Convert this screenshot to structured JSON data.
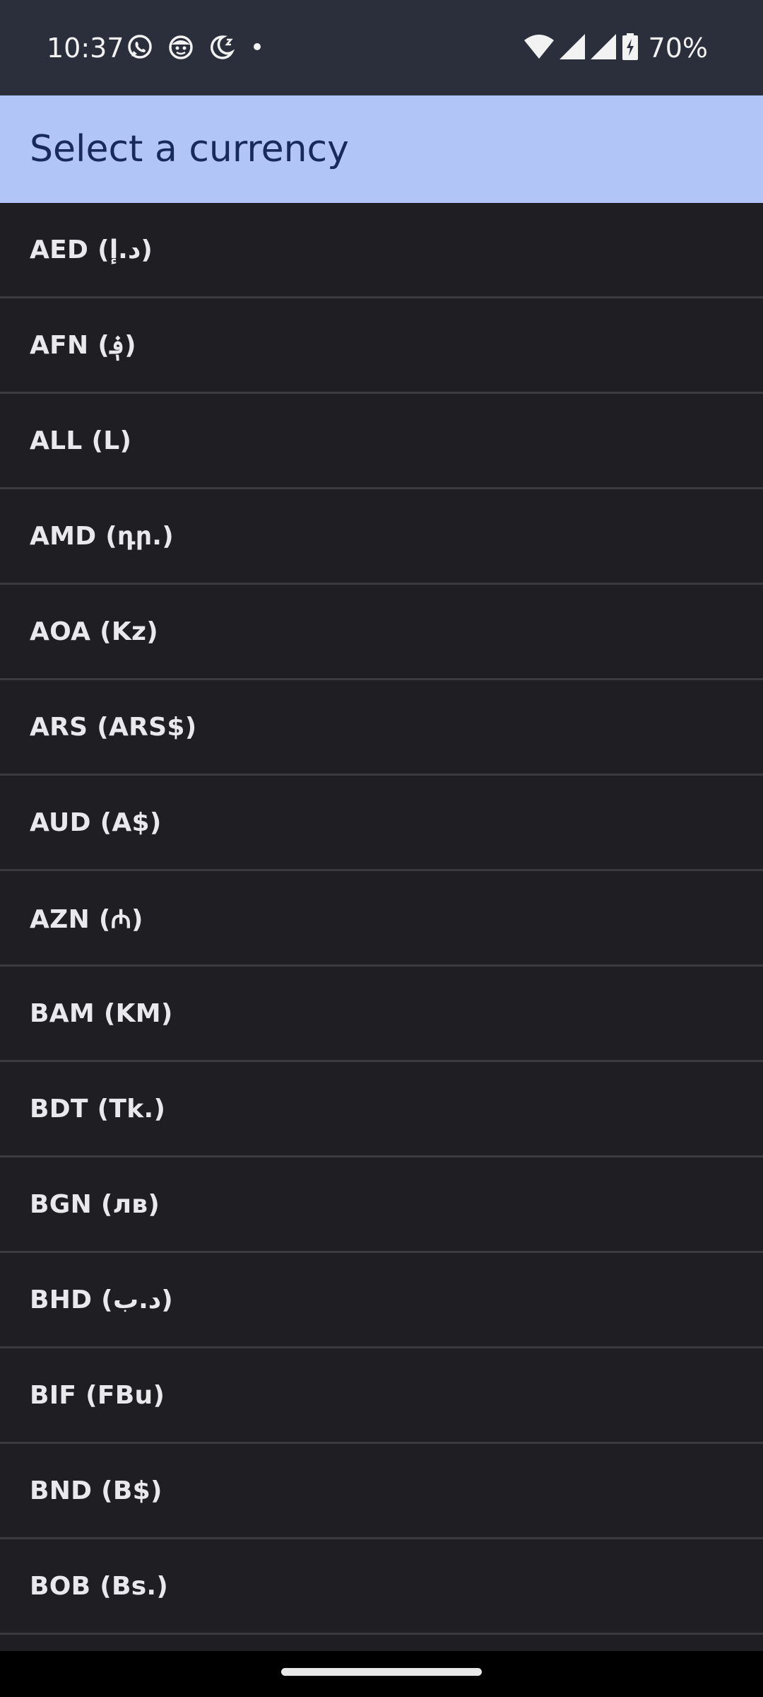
{
  "status_bar": {
    "time": "10:37",
    "battery_percent": "70%",
    "left_icons": [
      "whatsapp-icon",
      "smiley-icon",
      "bedtime-icon",
      "dot-icon"
    ],
    "right_icons": [
      "wifi-icon",
      "signal-icon",
      "signal-icon",
      "battery-charging-icon"
    ]
  },
  "header": {
    "title": "Select a currency",
    "background_color": "#b1c5f7",
    "title_color": "#172a5a"
  },
  "currencies": [
    {
      "label": "AED (د.إ)"
    },
    {
      "label": "AFN (؋)"
    },
    {
      "label": "ALL (L)"
    },
    {
      "label": "AMD (դր.)"
    },
    {
      "label": "AOA (Kz)"
    },
    {
      "label": "ARS (ARS$)"
    },
    {
      "label": "AUD (A$)"
    },
    {
      "label": "AZN (₼)"
    },
    {
      "label": "BAM (KM)"
    },
    {
      "label": "BDT (Tk.)"
    },
    {
      "label": "BGN (лв)"
    },
    {
      "label": "BHD (د.ب)"
    },
    {
      "label": "BIF (FBu)"
    },
    {
      "label": "BND (B$)"
    },
    {
      "label": "BOB (Bs.)"
    }
  ],
  "colors": {
    "list_background": "#1f1f23",
    "divider": "#3a3a3f",
    "text": "#e9e9ec"
  }
}
